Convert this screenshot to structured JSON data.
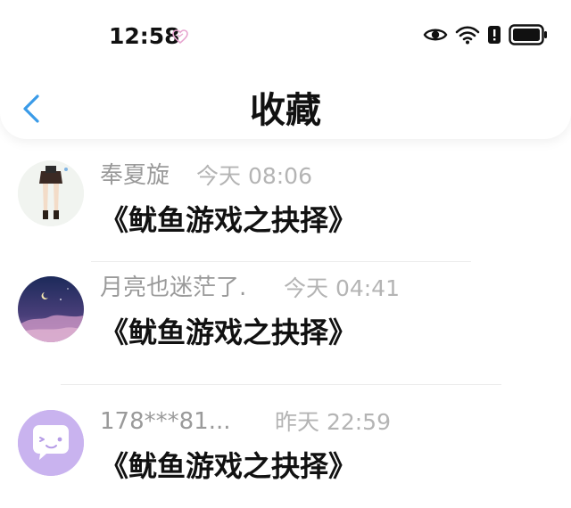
{
  "status_bar": {
    "time": "12:58",
    "icons": [
      "heart-icon",
      "eye-icon",
      "wifi-icon",
      "alert-icon",
      "battery-icon"
    ]
  },
  "header": {
    "title": "收藏",
    "back_icon": "chevron-left-icon",
    "accent_color": "#3a9be8"
  },
  "favorites": [
    {
      "name": "奉夏旋",
      "time": "今天 08:06",
      "content": "《鱿鱼游戏之抉择》",
      "avatar": "girl-illustration"
    },
    {
      "name": "月亮也迷茫了.",
      "time": "今天 04:41",
      "content": "《鱿鱼游戏之抉择》",
      "avatar": "night-sky"
    },
    {
      "name": "178***81...",
      "time": "昨天 22:59",
      "content": "《鱿鱼游戏之抉择》",
      "avatar": "chat-bubble-wink"
    }
  ]
}
